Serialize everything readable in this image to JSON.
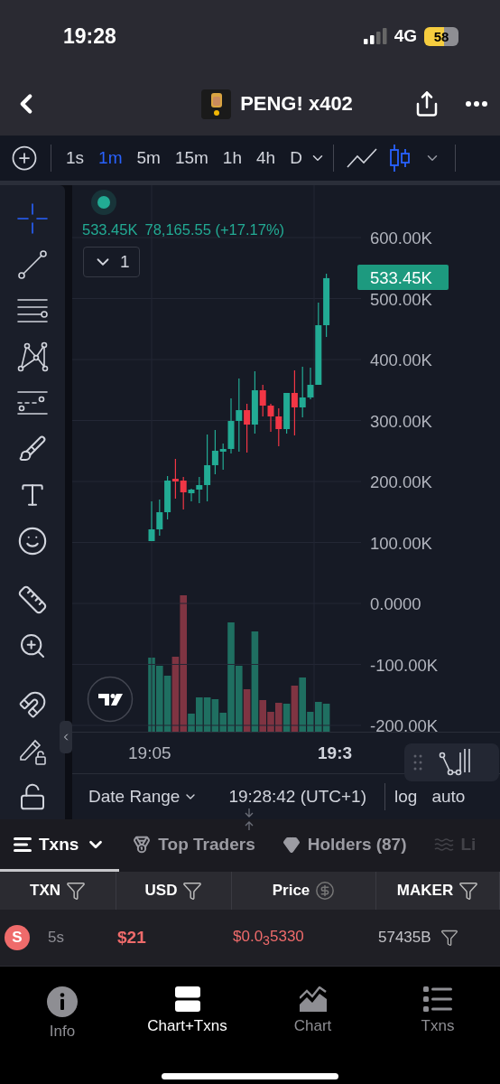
{
  "status_bar": {
    "time": "19:28",
    "network": "4G",
    "battery": "58"
  },
  "header": {
    "title": "PENG! x402"
  },
  "toolbar": {
    "intervals": [
      {
        "label": "1s",
        "selected": false
      },
      {
        "label": "1m",
        "selected": true
      },
      {
        "label": "5m",
        "selected": false
      },
      {
        "label": "15m",
        "selected": false
      },
      {
        "label": "1h",
        "selected": false
      },
      {
        "label": "4h",
        "selected": false
      },
      {
        "label": "D",
        "selected": false
      }
    ],
    "chart_types": [
      {
        "kind": "line",
        "selected": false
      },
      {
        "kind": "candles",
        "selected": true
      }
    ]
  },
  "drawing_tool_groups": [
    {
      "tools": [
        {
          "kind": "crosshair",
          "selected": true
        },
        {
          "kind": "trend_line",
          "selected": false
        },
        {
          "kind": "fib_lines",
          "selected": false
        },
        {
          "kind": "pattern",
          "selected": false
        },
        {
          "kind": "projection",
          "selected": false
        },
        {
          "kind": "brush",
          "selected": false
        },
        {
          "kind": "text",
          "selected": false
        },
        {
          "kind": "emoji",
          "selected": false
        }
      ]
    },
    {
      "tools": [
        {
          "kind": "ruler",
          "selected": false
        },
        {
          "kind": "zoom",
          "selected": false
        }
      ]
    },
    {
      "tools": [
        {
          "kind": "magnet",
          "selected": false
        },
        {
          "kind": "lock_drawings",
          "selected": false
        },
        {
          "kind": "lock",
          "selected": false
        }
      ]
    }
  ],
  "chart": {
    "legend": {
      "price": "533.45K",
      "change": "78,165.55 (+17.17%)"
    },
    "pane_button": "1",
    "chart_data": {
      "type": "candlestick",
      "grid": true,
      "ylim": [
        -210370,
        685926
      ],
      "yticks": [
        {
          "value": 600000,
          "label": "600.00K"
        },
        {
          "value": 500000,
          "label": "500.00K"
        },
        {
          "value": 400000,
          "label": "400.00K"
        },
        {
          "value": 300000,
          "label": "300.00K"
        },
        {
          "value": 200000,
          "label": "200.00K"
        },
        {
          "value": 100000,
          "label": "100.00K"
        },
        {
          "value": 0,
          "label": "0.0000"
        },
        {
          "value": -100000,
          "label": "-100.00K"
        },
        {
          "value": -200000,
          "label": "-200.00K"
        }
      ],
      "ohlc": [
        [
          102200,
          167400,
          102200,
          121500
        ],
        [
          121500,
          170400,
          111100,
          149600
        ],
        [
          149600,
          208900,
          137800,
          201500
        ],
        [
          204400,
          237000,
          171900,
          200000
        ],
        [
          201500,
          207400,
          154100,
          182200
        ],
        [
          180700,
          188100,
          167400,
          186700
        ],
        [
          186700,
          207400,
          164400,
          194100
        ],
        [
          194100,
          277000,
          167400,
          226700
        ],
        [
          226700,
          284400,
          211900,
          250400
        ],
        [
          248900,
          262200,
          219300,
          253300
        ],
        [
          253300,
          336300,
          245900,
          299300
        ],
        [
          299300,
          368900,
          248900,
          317000
        ],
        [
          317000,
          327400,
          247400,
          293300
        ],
        [
          293300,
          380700,
          278500,
          349600
        ],
        [
          349600,
          358500,
          306700,
          324400
        ],
        [
          324400,
          327400,
          281500,
          306700
        ],
        [
          306700,
          320000,
          257800,
          285900
        ],
        [
          285900,
          345200,
          278500,
          345200
        ],
        [
          345200,
          382200,
          275600,
          321500
        ],
        [
          321500,
          388100,
          305200,
          337800
        ],
        [
          337800,
          386700,
          334800,
          358500
        ],
        [
          358500,
          493300,
          358500,
          456300
        ],
        [
          456300,
          540700,
          437000,
          533450
        ]
      ]
    },
    "last_price": "533.45K",
    "time_labels": [
      {
        "label": "19:05",
        "bold": false
      },
      {
        "label": "19:3",
        "bold": true
      }
    ]
  },
  "chart_footer": {
    "date_range": "Date Range",
    "time": "19:28:42 (UTC+1)",
    "scale_options": [
      "log",
      "auto"
    ]
  },
  "tabs": [
    {
      "kind": "txns",
      "label": "Txns",
      "selected": true
    },
    {
      "kind": "traders",
      "label": "Top Traders",
      "selected": false
    },
    {
      "kind": "holders",
      "label": "Holders (87)",
      "selected": false
    },
    {
      "kind": "liquidity",
      "label": "Li",
      "selected": false
    }
  ],
  "table": {
    "columns": [
      {
        "kind": "filter",
        "label": "TXN"
      },
      {
        "kind": "filter",
        "label": "USD"
      },
      {
        "kind": "currency",
        "label": "Price"
      },
      {
        "kind": "filter",
        "label": "MAKER"
      }
    ],
    "rows": [
      {
        "kind": "sell",
        "type": "S",
        "age": "5s",
        "usd": "$21",
        "price": "$0.0$_{3}$5330",
        "maker": "57435B"
      }
    ]
  },
  "bottom_nav": [
    {
      "kind": "info",
      "label": "Info",
      "selected": false
    },
    {
      "kind": "split",
      "label": "Chart+Txns",
      "selected": true
    },
    {
      "kind": "chart",
      "label": "Chart",
      "selected": false
    },
    {
      "kind": "list",
      "label": "Txns",
      "selected": false
    }
  ]
}
